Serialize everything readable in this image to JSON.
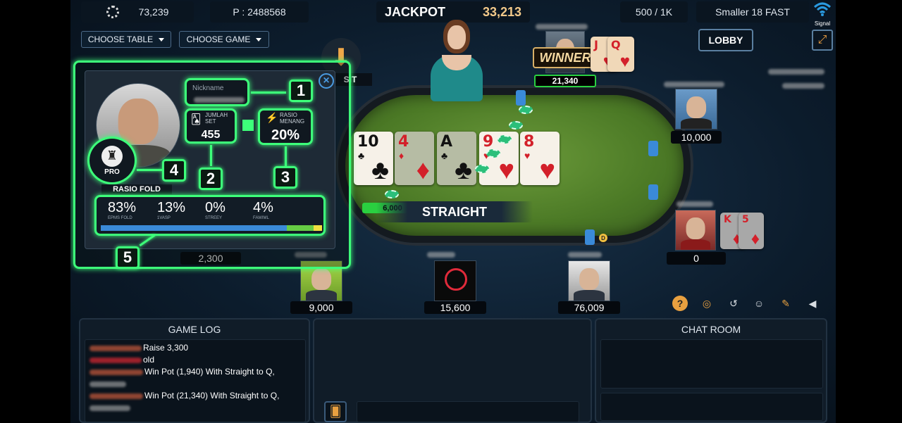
{
  "topbar": {
    "coins": "73,239",
    "points": "P : 2488568",
    "jackpot_label": "JACKPOT",
    "jackpot_value": "33,213",
    "blinds": "500 / 1K",
    "table_name": "Smaller 18 FAST",
    "signal_label": "Signal"
  },
  "controls": {
    "choose_table": "CHOOSE TABLE",
    "choose_game": "CHOOSE GAME",
    "lobby": "LOBBY",
    "deposit_label": "SIT"
  },
  "table": {
    "community_cards": [
      {
        "rank": "10",
        "suit": "♣",
        "color": "black",
        "dim": false
      },
      {
        "rank": "4",
        "suit": "♦",
        "color": "red",
        "dim": true
      },
      {
        "rank": "A",
        "suit": "♣",
        "color": "black",
        "dim": true
      },
      {
        "rank": "9",
        "suit": "♥",
        "color": "red",
        "dim": false
      },
      {
        "rank": "8",
        "suit": "♥",
        "color": "red",
        "dim": false
      }
    ],
    "pot_amount": "6,000",
    "hand_result": "STRAIGHT",
    "dealer_button": "D"
  },
  "winner": {
    "badge": "WINNER",
    "stack": "21,340",
    "cards": [
      {
        "rank": "J",
        "suit": "♥"
      },
      {
        "rank": "Q",
        "suit": "♥"
      }
    ]
  },
  "players": {
    "right_top_stack": "10,000",
    "right_bottom_stack": "0",
    "right_bottom_cards": [
      {
        "rank": "K",
        "suit": "♦"
      },
      {
        "rank": "5",
        "suit": "♦"
      }
    ],
    "left_stack": "2,300",
    "bottom_left_stack": "9,000",
    "bottom_center_stack": "15,600",
    "bottom_right_stack": "76,009"
  },
  "tutorial": {
    "nickname_label": "Nickname",
    "sets_label": "JUMLAH SET",
    "sets_value": "455",
    "win_label": "RASIO MENANG",
    "win_value": "20%",
    "rank_badge": "PRO",
    "fold_label": "RASIO FOLD",
    "stats": [
      {
        "value": "83%",
        "label": "EPMS FOLD"
      },
      {
        "value": "13%",
        "label": "1VASP"
      },
      {
        "value": "0%",
        "label": "STREEY"
      },
      {
        "value": "4%",
        "label": "FAWIML"
      }
    ],
    "callouts": [
      "1",
      "2",
      "3",
      "4",
      "5"
    ],
    "colors": {
      "highlight": "#3dff7a",
      "bar_blue": "#3a8ad8",
      "bar_green": "#66cc44",
      "bar_yellow": "#f0e040"
    }
  },
  "bottom": {
    "game_log_title": "GAME LOG",
    "chat_room_title": "CHAT ROOM",
    "log_lines": [
      "Raise 3,300",
      "old",
      "Win Pot (1,940) With Straight to Q,",
      "Win Pot (21,340) With Straight to Q,"
    ]
  },
  "toolbar_icons": [
    "help-icon",
    "chips-icon",
    "history-icon",
    "emoji-icon",
    "chat-icon",
    "sound-icon"
  ]
}
